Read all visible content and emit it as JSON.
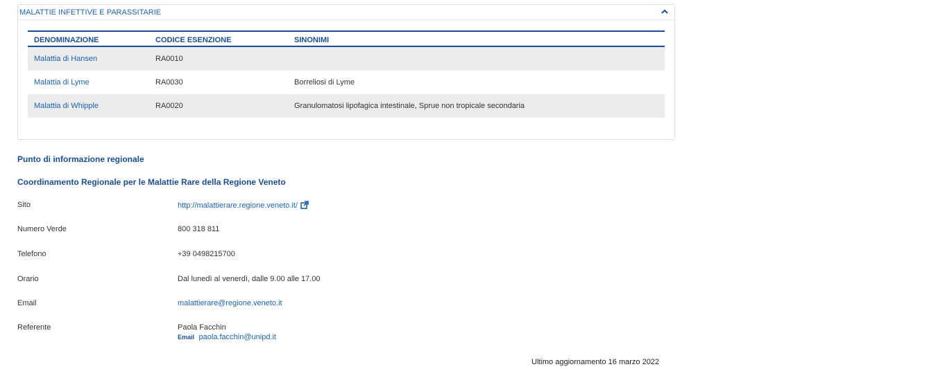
{
  "accordion": {
    "title": "MALATTIE INFETTIVE E PARASSITARIE",
    "chevron_icon": "chevron-up-icon",
    "columns": [
      "DENOMINAZIONE",
      "CODICE ESENZIONE",
      "SINONIMI"
    ],
    "rows": [
      {
        "name": "Malattia di Hansen",
        "code": "RA0010",
        "synonyms": ""
      },
      {
        "name": "Malattia di Lyme",
        "code": "RA0030",
        "synonyms": "Borreliosi di Lyme"
      },
      {
        "name": "Malattia di Whipple",
        "code": "RA0020",
        "synonyms": "Granulomatosi lipofagica intestinale, Sprue non tropicale secondaria"
      }
    ]
  },
  "info": {
    "section_title": "Punto di informazione regionale",
    "org_title": "Coordinamento Regionale per le Malattie Rare della Regione Veneto",
    "fields": [
      {
        "label": "Sito",
        "value": "http://malattierare.regione.veneto.it/"
      },
      {
        "label": "Numero Verde",
        "value": "800 318 811"
      },
      {
        "label": "Telefono",
        "value": "+39 0498215700"
      },
      {
        "label": "Orario",
        "value": "Dal lunedì al venerdì, dalle 9.00 alle 17.00"
      },
      {
        "label": "Email",
        "value": "malattierare@regione.veneto.it"
      },
      {
        "label": "Referente",
        "value": "Paola Facchin"
      }
    ],
    "referente_email_label": "Email",
    "referente_email": "paola.facchin@unipd.it",
    "external_link_icon": "external-link-icon"
  },
  "footer": {
    "updated": "Ultimo aggiornamento 16 marzo 2022"
  },
  "colors": {
    "link": "#1a62b6",
    "heading": "#1a4e96",
    "stripe": "#ececec"
  }
}
